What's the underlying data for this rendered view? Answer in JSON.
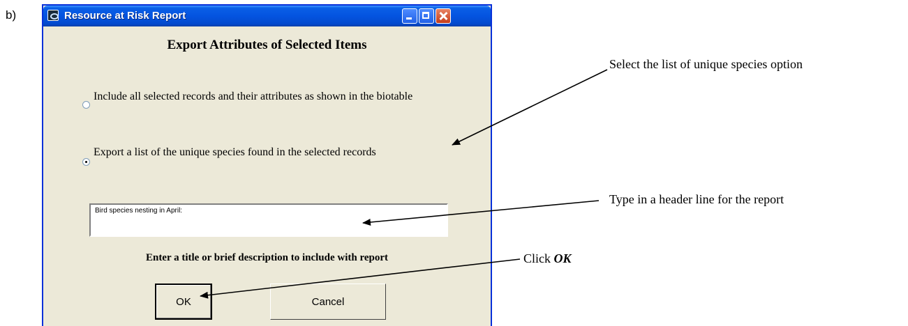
{
  "panel_label": "b)",
  "window": {
    "title": "Resource at Risk Report",
    "app_icon": "app-icon"
  },
  "dialog": {
    "heading": "Export Attributes of Selected Items",
    "options": [
      {
        "label": "Include all selected records and their attributes as shown in the biotable",
        "selected": false
      },
      {
        "label": "Export a list of the unique species found in the selected records",
        "selected": true
      }
    ],
    "header_input_value": "Bird species nesting in April:",
    "caption": "Enter a title or brief description to include with report",
    "ok_label": "OK",
    "cancel_label": "Cancel"
  },
  "callouts": {
    "select_option": "Select the list of unique species option",
    "type_header": "Type in a header line for the report",
    "click_prefix": "Click ",
    "click_target": "OK"
  }
}
